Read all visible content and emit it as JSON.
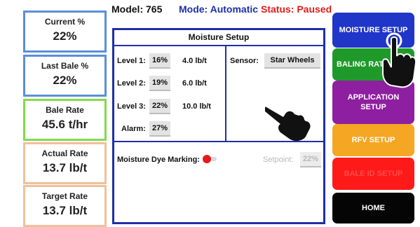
{
  "stats": [
    {
      "label": "Current %",
      "value": "22%",
      "border": "#5b8fd6"
    },
    {
      "label": "Last Bale %",
      "value": "22%",
      "border": "#5b8fd6"
    },
    {
      "label": "Bale Rate",
      "value": "45.6 t/hr",
      "border": "#84d94e"
    },
    {
      "label": "Actual Rate",
      "value": "13.7 lb/t",
      "border": "#f0c09a"
    },
    {
      "label": "Target Rate",
      "value": "13.7 lb/t",
      "border": "#f0c09a"
    }
  ],
  "header": {
    "model": "Model:  765",
    "mode": "Mode: Automatic",
    "status": "Status: Paused"
  },
  "panel": {
    "title": "Moisture Setup",
    "levels": [
      {
        "label": "Level 1:",
        "pct": "16%",
        "rate": "4.0 lb/t"
      },
      {
        "label": "Level 2:",
        "pct": "19%",
        "rate": "6.0 lb/t"
      },
      {
        "label": "Level 3:",
        "pct": "22%",
        "rate": "10.0 lb/t"
      }
    ],
    "alarm_label": "Alarm:",
    "alarm_value": "27%",
    "sensor_label": "Sensor:",
    "sensor_value": "Star Wheels",
    "dye_label": "Moisture Dye Marking:",
    "setpoint_label": "Setpoint:",
    "setpoint_value": "22%"
  },
  "buttons": [
    {
      "label": "MOISTURE SETUP",
      "color": "#1f36c9"
    },
    {
      "label": "BALING RATE",
      "color": "#1f9a2a"
    },
    {
      "label": "APPLICATION SETUP",
      "color": "#8e1fa0"
    },
    {
      "label": "RFV SETUP",
      "color": "#f5a623"
    },
    {
      "label": "BALE ID SETUP",
      "color": "#ff1a1a"
    },
    {
      "label": "HOME",
      "color": "#050505"
    }
  ],
  "icons": [
    "hand-pointer-icon",
    "hand-pointer-icon",
    "toggle-icon"
  ]
}
